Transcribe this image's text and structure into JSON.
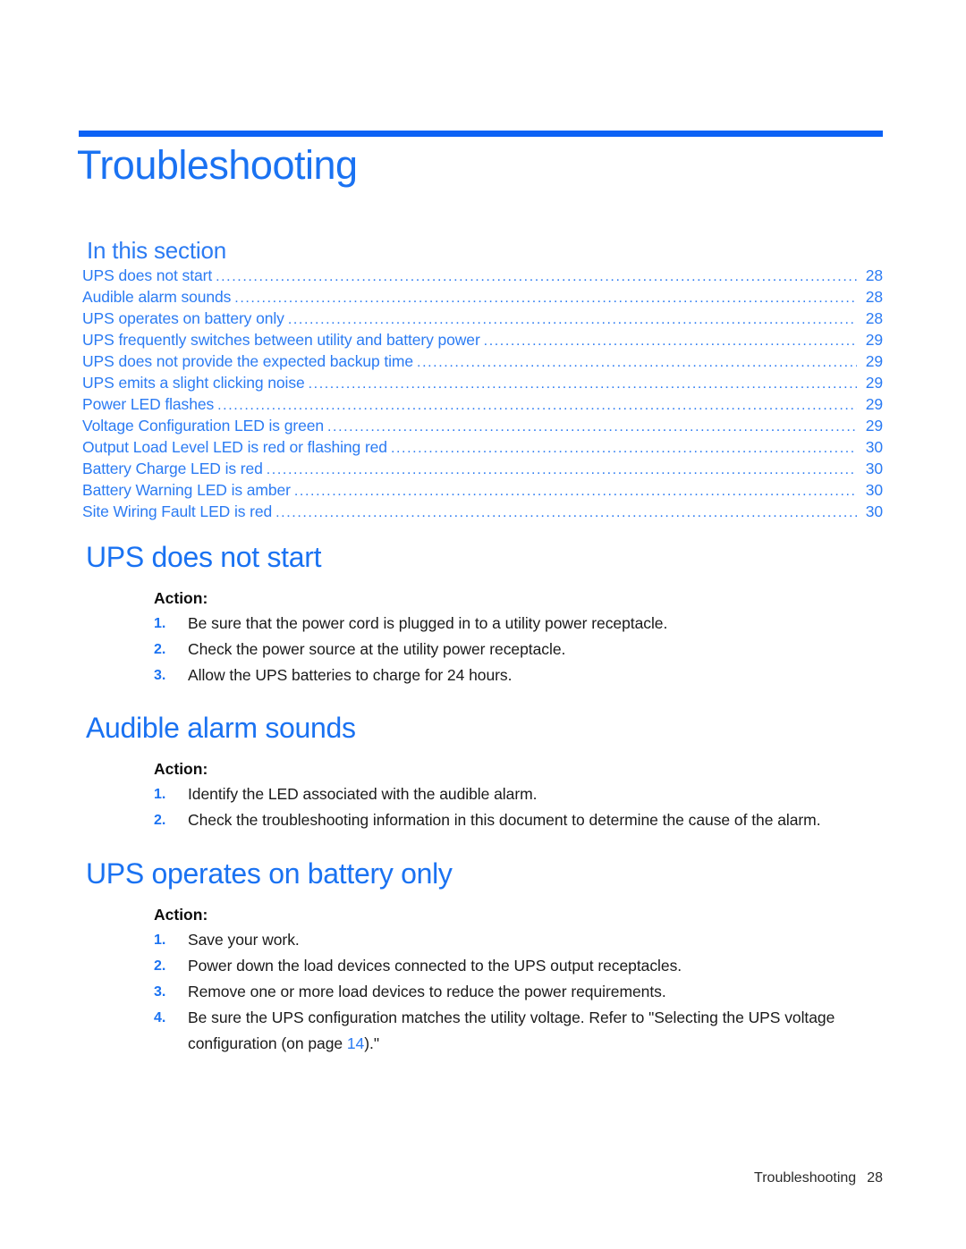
{
  "chapter": {
    "title": "Troubleshooting",
    "rule_color": "#0c62f5",
    "title_color": "#1a72f2"
  },
  "in_this_section": {
    "heading": "In this section",
    "entries": [
      {
        "label": "UPS does not start",
        "page": "28"
      },
      {
        "label": "Audible alarm sounds",
        "page": "28"
      },
      {
        "label": "UPS operates on battery only",
        "page": "28"
      },
      {
        "label": "UPS frequently switches between utility and battery power",
        "page": "29"
      },
      {
        "label": "UPS does not provide the expected backup time",
        "page": "29"
      },
      {
        "label": "UPS emits a slight clicking noise",
        "page": "29"
      },
      {
        "label": "Power LED flashes",
        "page": "29"
      },
      {
        "label": "Voltage Configuration LED is green",
        "page": "29"
      },
      {
        "label": "Output Load Level LED is red or flashing red",
        "page": "30"
      },
      {
        "label": "Battery Charge LED is red",
        "page": "30"
      },
      {
        "label": "Battery Warning LED is amber",
        "page": "30"
      },
      {
        "label": "Site Wiring Fault LED is red",
        "page": "30"
      }
    ]
  },
  "sections": [
    {
      "heading": "UPS does not start",
      "action_label": "Action:",
      "steps": [
        {
          "num": "1.",
          "text": "Be sure that the power cord is plugged in to a utility power receptacle."
        },
        {
          "num": "2.",
          "text": "Check the power source at the utility power receptacle."
        },
        {
          "num": "3.",
          "text": "Allow the UPS batteries to charge for 24 hours."
        }
      ]
    },
    {
      "heading": "Audible alarm sounds",
      "action_label": "Action:",
      "steps": [
        {
          "num": "1.",
          "text": "Identify the LED associated with the audible alarm."
        },
        {
          "num": "2.",
          "text": "Check the troubleshooting information in this document to determine the cause of the alarm."
        }
      ]
    },
    {
      "heading": "UPS operates on battery only",
      "action_label": "Action:",
      "steps": [
        {
          "num": "1.",
          "text": "Save your work."
        },
        {
          "num": "2.",
          "text": "Power down the load devices connected to the UPS output receptacles."
        },
        {
          "num": "3.",
          "text": "Remove one or more load devices to reduce the power requirements."
        },
        {
          "num": "4.",
          "text_before": "Be sure the UPS configuration matches the utility voltage. Refer to \"Selecting the UPS voltage configuration (on page ",
          "xref": "14",
          "text_after": ").\""
        }
      ]
    }
  ],
  "footer": {
    "chapter_name": "Troubleshooting",
    "page_number": "28"
  }
}
